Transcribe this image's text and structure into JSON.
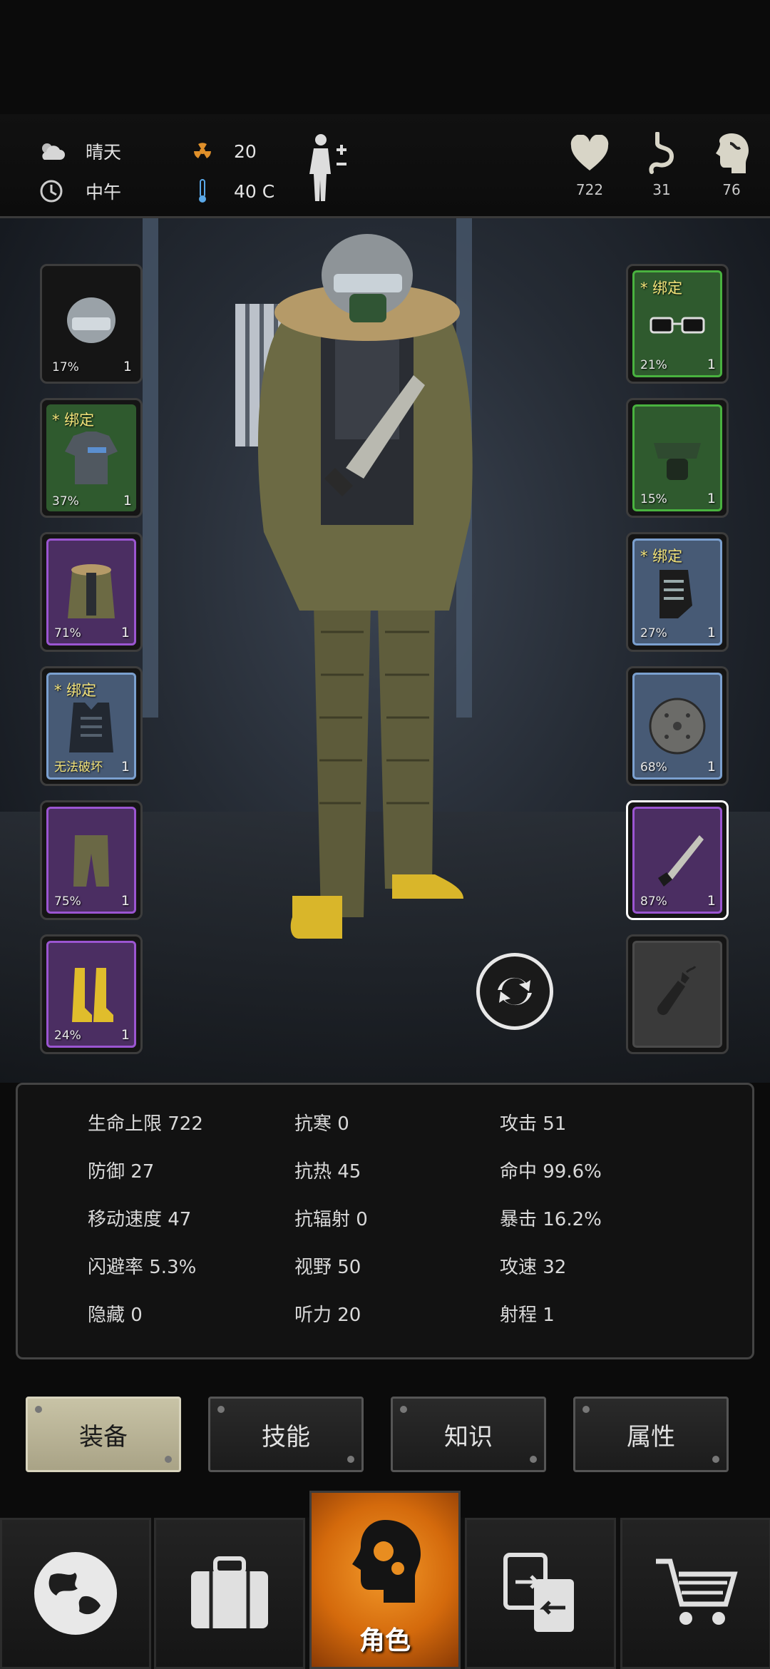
{
  "status": {
    "weather": "晴天",
    "time_of_day": "中午",
    "radiation": "20",
    "temperature": "40 C",
    "health": "722",
    "hunger": "31",
    "mental": "76"
  },
  "equipment": {
    "left": [
      {
        "name": "helmet",
        "rarity": "blue",
        "percent": "17%",
        "count": "1",
        "bound": ""
      },
      {
        "name": "tshirt",
        "rarity": "green",
        "percent": "37%",
        "count": "1",
        "bound": "* 绑定"
      },
      {
        "name": "fur-jacket",
        "rarity": "purple",
        "percent": "71%",
        "count": "1",
        "bound": ""
      },
      {
        "name": "vest",
        "rarity": "blue",
        "percent": "无法破坏",
        "count": "1",
        "bound": "* 绑定"
      },
      {
        "name": "pants",
        "rarity": "purple",
        "percent": "75%",
        "count": "1",
        "bound": ""
      },
      {
        "name": "boots",
        "rarity": "purple",
        "percent": "24%",
        "count": "1",
        "bound": ""
      }
    ],
    "right": [
      {
        "name": "glasses",
        "rarity": "green",
        "percent": "21%",
        "count": "1",
        "bound": "* 绑定"
      },
      {
        "name": "gas-mask",
        "rarity": "green",
        "percent": "15%",
        "count": "1",
        "bound": ""
      },
      {
        "name": "gloves",
        "rarity": "blue",
        "percent": "27%",
        "count": "1",
        "bound": "* 绑定"
      },
      {
        "name": "shield",
        "rarity": "blue",
        "percent": "68%",
        "count": "1",
        "bound": ""
      },
      {
        "name": "machete",
        "rarity": "purple",
        "percent": "87%",
        "count": "1",
        "bound": ""
      },
      {
        "name": "throwable-empty",
        "rarity": "grey",
        "percent": "",
        "count": "",
        "bound": ""
      }
    ]
  },
  "stats": {
    "col1": [
      "生命上限 722",
      "防御 27",
      "移动速度 47",
      "闪避率 5.3%",
      "隐藏 0"
    ],
    "col2": [
      "抗寒 0",
      "抗热 45",
      "抗辐射 0",
      "视野 50",
      "听力 20"
    ],
    "col3": [
      "攻击 51",
      "命中 99.6%",
      "暴击 16.2%",
      "攻速 32",
      "射程 1"
    ]
  },
  "tabs": [
    "装备",
    "技能",
    "知识",
    "属性"
  ],
  "nav": {
    "active_label": "角色",
    "items": [
      "world-map",
      "backpack",
      "character",
      "trade",
      "shop"
    ]
  },
  "colors": {
    "accent": "#e07a14",
    "blue_rarity": "#7ba0cf",
    "green_rarity": "#49b23f",
    "purple_rarity": "#9b55d1",
    "bound_text": "#f3e37a"
  }
}
